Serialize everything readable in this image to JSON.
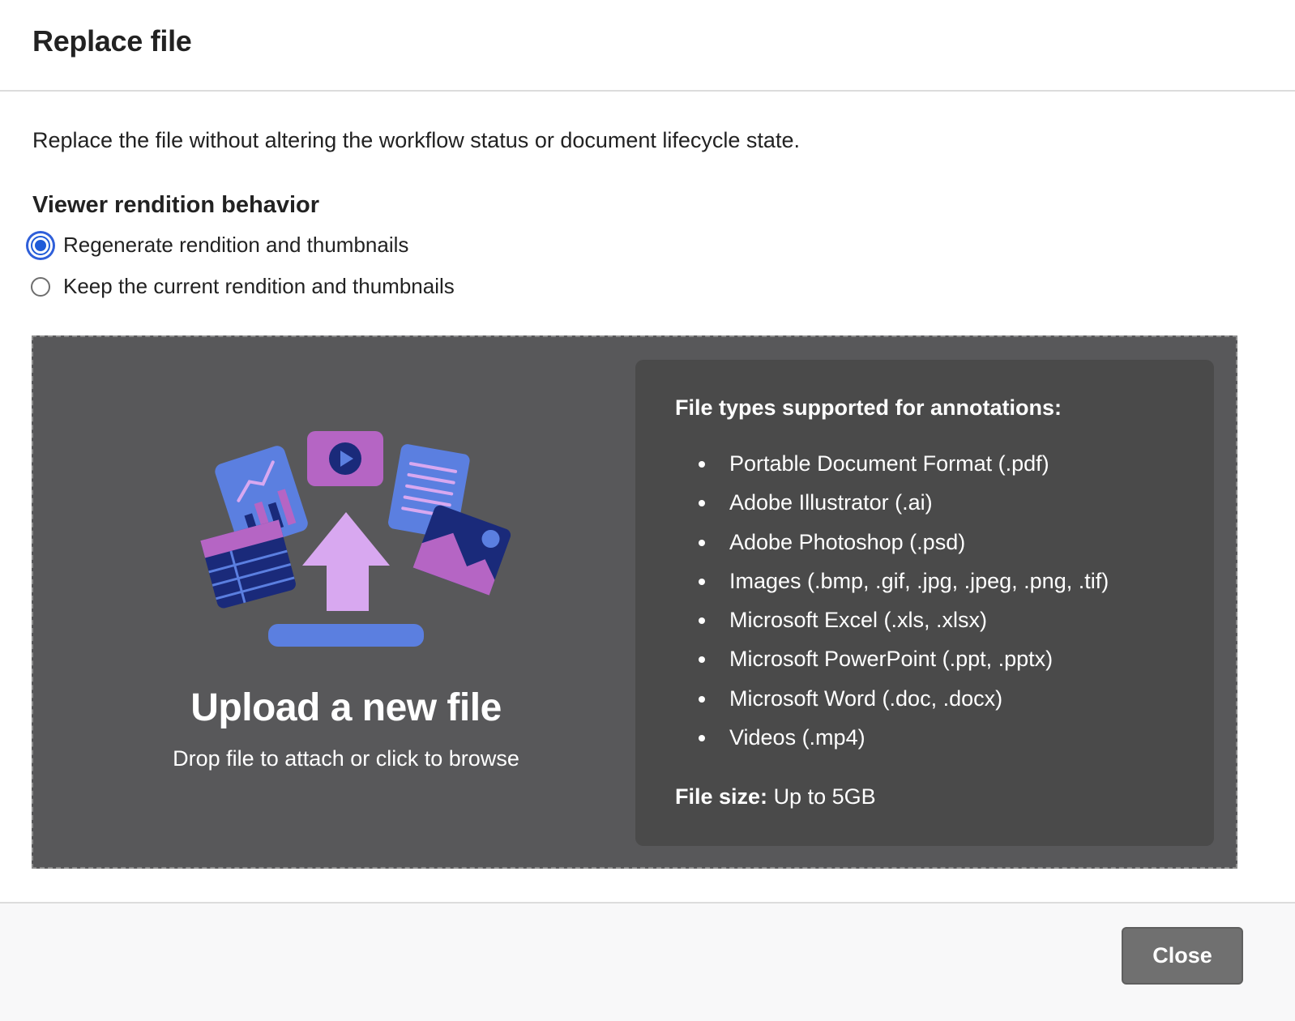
{
  "dialog": {
    "title": "Replace file",
    "description": "Replace the file without altering the workflow status or document lifecycle state."
  },
  "rendition": {
    "heading": "Viewer rendition behavior",
    "options": [
      {
        "label": "Regenerate rendition and thumbnails",
        "selected": true
      },
      {
        "label": "Keep the current rendition and thumbnails",
        "selected": false
      }
    ]
  },
  "upload": {
    "title": "Upload a new file",
    "subtitle": "Drop file to attach or click to browse"
  },
  "supported": {
    "heading": "File types supported for annotations:",
    "types": [
      "Portable Document Format (.pdf)",
      "Adobe Illustrator (.ai)",
      "Adobe Photoshop (.psd)",
      "Images (.bmp, .gif, .jpg, .jpeg, .png, .tif)",
      "Microsoft Excel (.xls, .xlsx)",
      "Microsoft PowerPoint (.ppt, .pptx)",
      "Microsoft Word (.doc, .docx)",
      "Videos (.mp4)"
    ],
    "size_label": "File size:",
    "size_value": "Up to 5GB"
  },
  "footer": {
    "close_label": "Close"
  },
  "colors": {
    "accent": "#1f5bd8",
    "dropzone_bg": "#58585a",
    "panel_bg": "#4a4a4a",
    "illus_blue": "#5b7fe0",
    "illus_purple": "#b565c4",
    "illus_navy": "#1a2a7a",
    "illus_lilac": "#d8a8f0"
  },
  "icons": {
    "illustration": "upload-files-illustration"
  }
}
